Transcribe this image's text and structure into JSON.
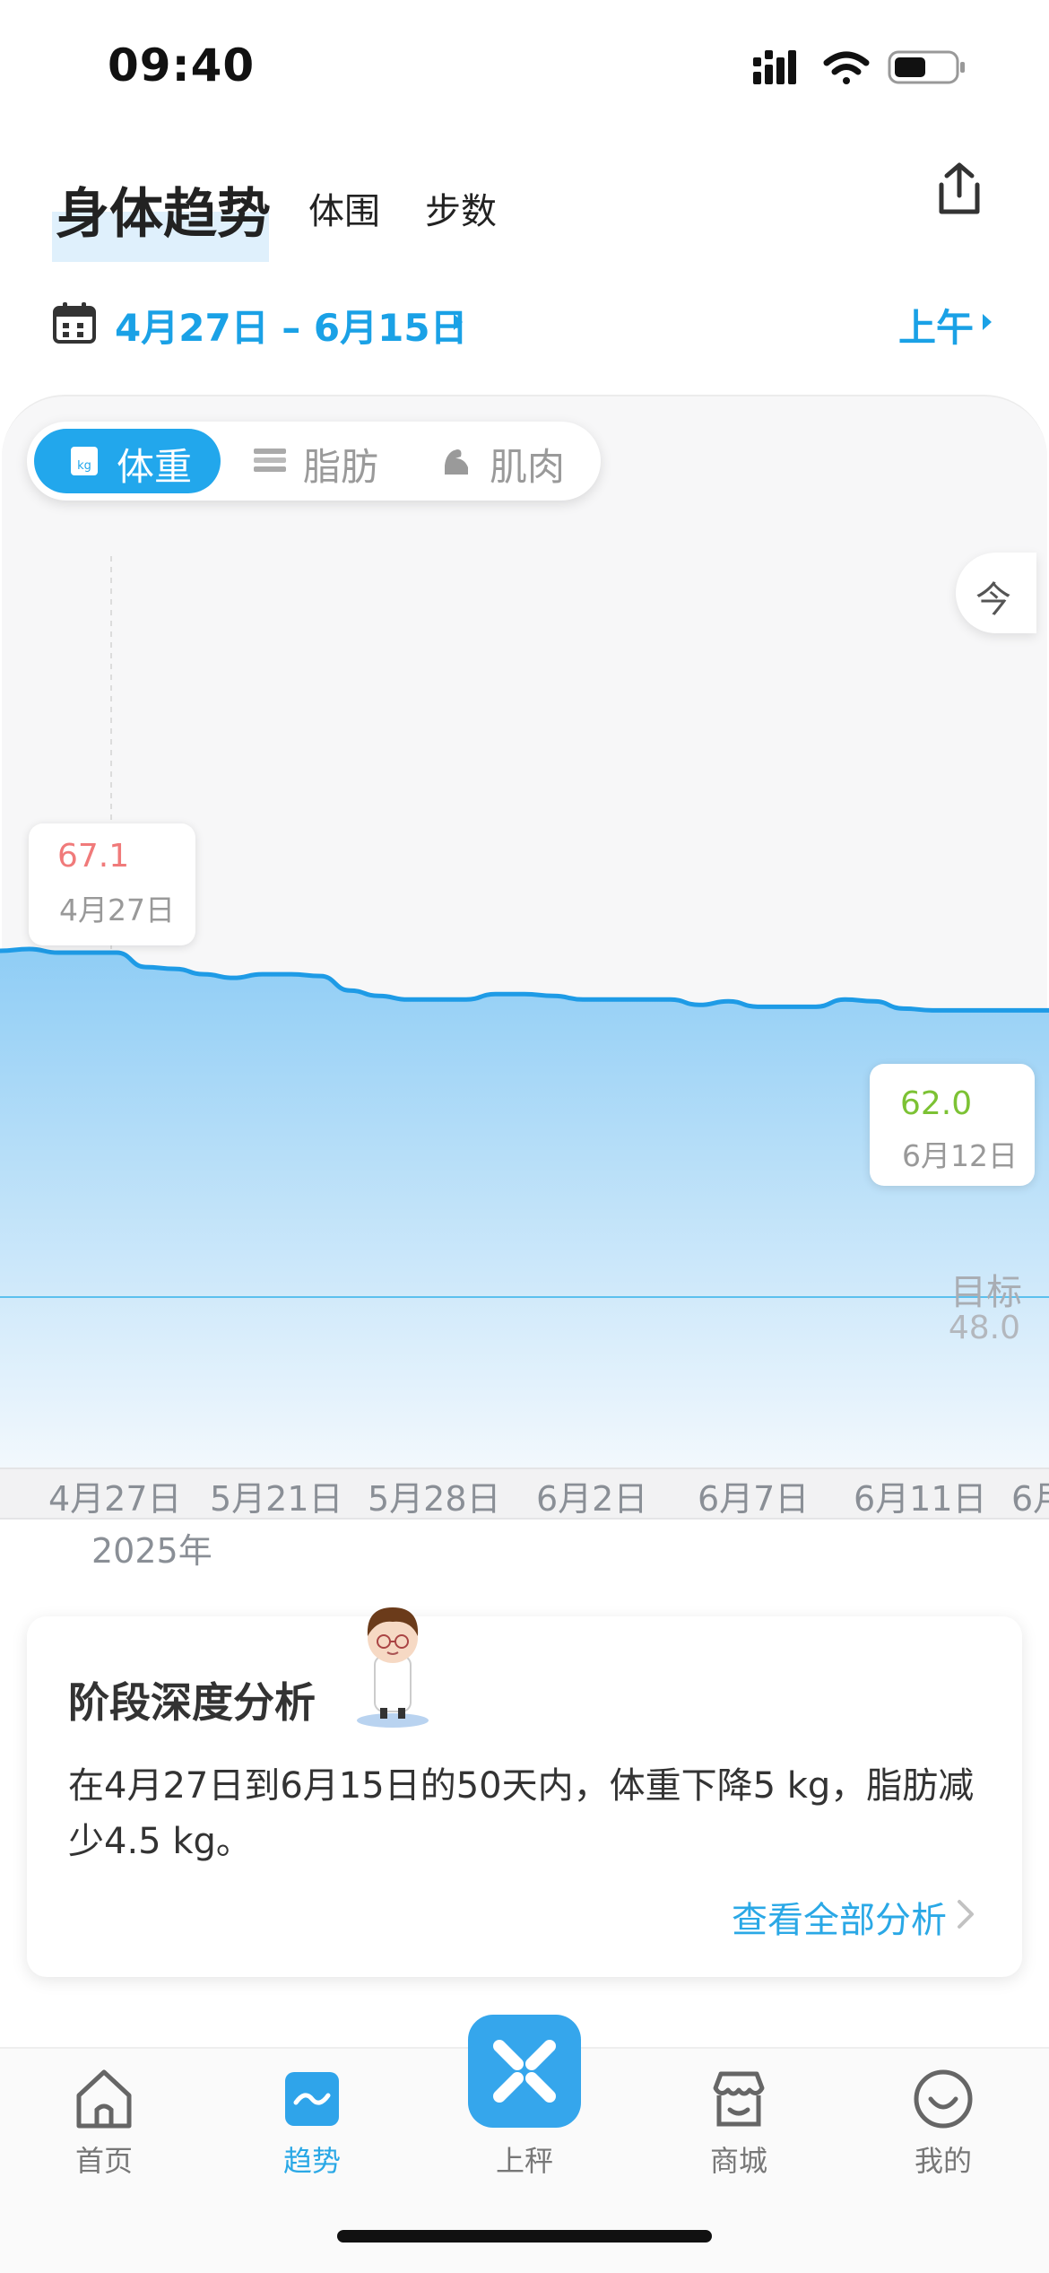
{
  "status_bar": {
    "time": "09:40"
  },
  "header": {
    "title": "身体趋势",
    "tabs": [
      "体围",
      "步数"
    ]
  },
  "date_range": {
    "label": "4月27日 – 6月15日",
    "period": "上午"
  },
  "metric_tabs": [
    {
      "label": "体重",
      "icon": "kg-scale-icon",
      "active": true
    },
    {
      "label": "脂肪",
      "icon": "fat-icon",
      "active": false
    },
    {
      "label": "肌肉",
      "icon": "muscle-icon",
      "active": false
    }
  ],
  "today_button": "今",
  "chart_data": {
    "type": "area",
    "title": "",
    "xlabel": "",
    "ylabel": "",
    "x_ticks": [
      "4月27日",
      "5月21日",
      "5月28日",
      "6月2日",
      "6月7日",
      "6月11日",
      "6月"
    ],
    "year_label": "2025年",
    "ylim": [
      40,
      75
    ],
    "series": [
      {
        "values": [
          67.2,
          67.3,
          67.1,
          67.1,
          67.1,
          66.3,
          66.2,
          65.9,
          65.7,
          65.9,
          65.9,
          65.8,
          65.0,
          64.7,
          64.5,
          64.5,
          64.5,
          64.8,
          64.8,
          64.7,
          64.5,
          64.5,
          64.5,
          64.5,
          64.2,
          64.4,
          64.1,
          64.1,
          64.1,
          64.5,
          64.4,
          64.0,
          63.9,
          63.9,
          63.9,
          63.9,
          63.9
        ],
        "color": "#1e9be6"
      }
    ],
    "start_point": {
      "value": "67.1",
      "date": "4月27日"
    },
    "end_point": {
      "value": "62.0",
      "date": "6月12日"
    },
    "goal": {
      "label": "目标",
      "value": "48.0",
      "numeric": 48.0
    },
    "grid": false
  },
  "analysis": {
    "title": "阶段深度分析",
    "text": "在4月27日到6月15日的50天内，体重下降5 kg，脂肪减少4.5 kg。",
    "link": "查看全部分析"
  },
  "bottom_nav": [
    {
      "label": "首页",
      "icon": "home-icon",
      "active": false
    },
    {
      "label": "趋势",
      "icon": "trend-icon",
      "active": true
    },
    {
      "label": "上秤",
      "icon": "scale-icon",
      "active": false
    },
    {
      "label": "商城",
      "icon": "shop-icon",
      "active": false
    },
    {
      "label": "我的",
      "icon": "profile-icon",
      "active": false
    }
  ],
  "colors": {
    "accent": "#22a7ec",
    "start_value": "#f07a7a",
    "end_value": "#7cc234"
  }
}
